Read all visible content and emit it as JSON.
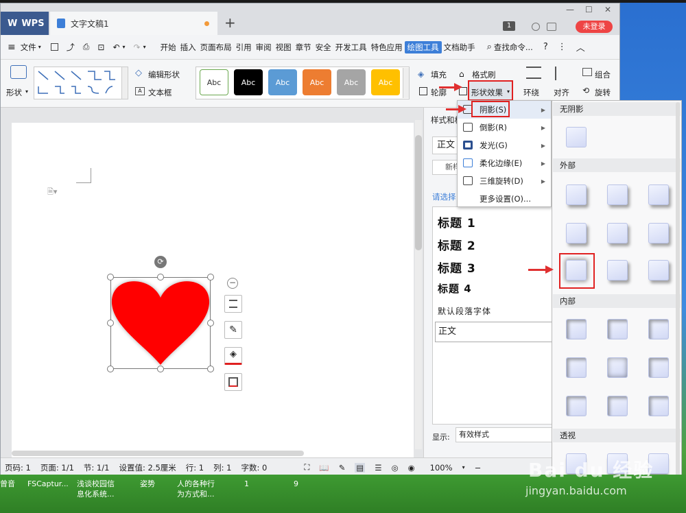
{
  "window": {
    "app_tab": "WPS",
    "doc_tab": "文字文稿1",
    "login": "未登录",
    "badge": "1"
  },
  "menubar": {
    "file": "文件",
    "items": [
      "开始",
      "插入",
      "页面布局",
      "引用",
      "审阅",
      "视图",
      "章节",
      "安全",
      "开发工具",
      "特色应用",
      "绘图工具",
      "文档助手"
    ],
    "active": "绘图工具",
    "search": "查找命令..."
  },
  "ribbon": {
    "shape": "形状",
    "edit_shape": "编辑形状",
    "textbox": "文本框",
    "style_abc": [
      "Abc",
      "Abc",
      "Abc",
      "Abc",
      "Abc",
      "Abc"
    ],
    "style_colors": [
      "#ffffff",
      "#000000",
      "#5b9bd5",
      "#ed7d31",
      "#a5a5a5",
      "#ffc000"
    ],
    "fill": "填充",
    "format_brush": "格式刷",
    "outline": "轮廓",
    "shape_effect": "形状效果",
    "wrap": "环绕",
    "align": "对齐",
    "group": "组合",
    "rotate": "旋转"
  },
  "dropdown": {
    "items": [
      {
        "label": "阴影(S)",
        "arrow": true
      },
      {
        "label": "倒影(R)",
        "arrow": true
      },
      {
        "label": "发光(G)",
        "arrow": true
      },
      {
        "label": "柔化边缘(E)",
        "arrow": true
      },
      {
        "label": "三维旋转(D)",
        "arrow": true
      },
      {
        "label": "更多设置(O)...",
        "arrow": false
      }
    ]
  },
  "gallery": {
    "no_shadow": "无阴影",
    "outer": "外部",
    "inner": "内部",
    "perspective": "透视"
  },
  "panel": {
    "title": "样式和格",
    "body_style": "正文",
    "new": "新样",
    "select_label": "请选择",
    "headings": [
      "标题 1",
      "标题 2",
      "标题 3",
      "标题 4"
    ],
    "default_font": "默认段落字体",
    "body": "正文",
    "show_label": "显示:",
    "show_value": "有效样式"
  },
  "statusbar": {
    "page": "页码: 1",
    "pages": "页面: 1/1",
    "section": "节: 1/1",
    "setting": "设置值: 2.5厘米",
    "row": "行: 1",
    "col": "列: 1",
    "words": "字数: 0",
    "zoom": "100%"
  },
  "taskbar": {
    "items": [
      "曾音",
      "FSCaptur...",
      "浅谈校园信\n息化系统...",
      "姿势",
      "人的各种行\n为方式和...",
      "1",
      "9"
    ]
  },
  "watermark": {
    "logo": "Bai du 经验",
    "url": "jingyan.baidu.com"
  },
  "colors": {
    "heart": "#ff0000",
    "highlight": "#e02020",
    "accent": "#3d7fd8"
  }
}
